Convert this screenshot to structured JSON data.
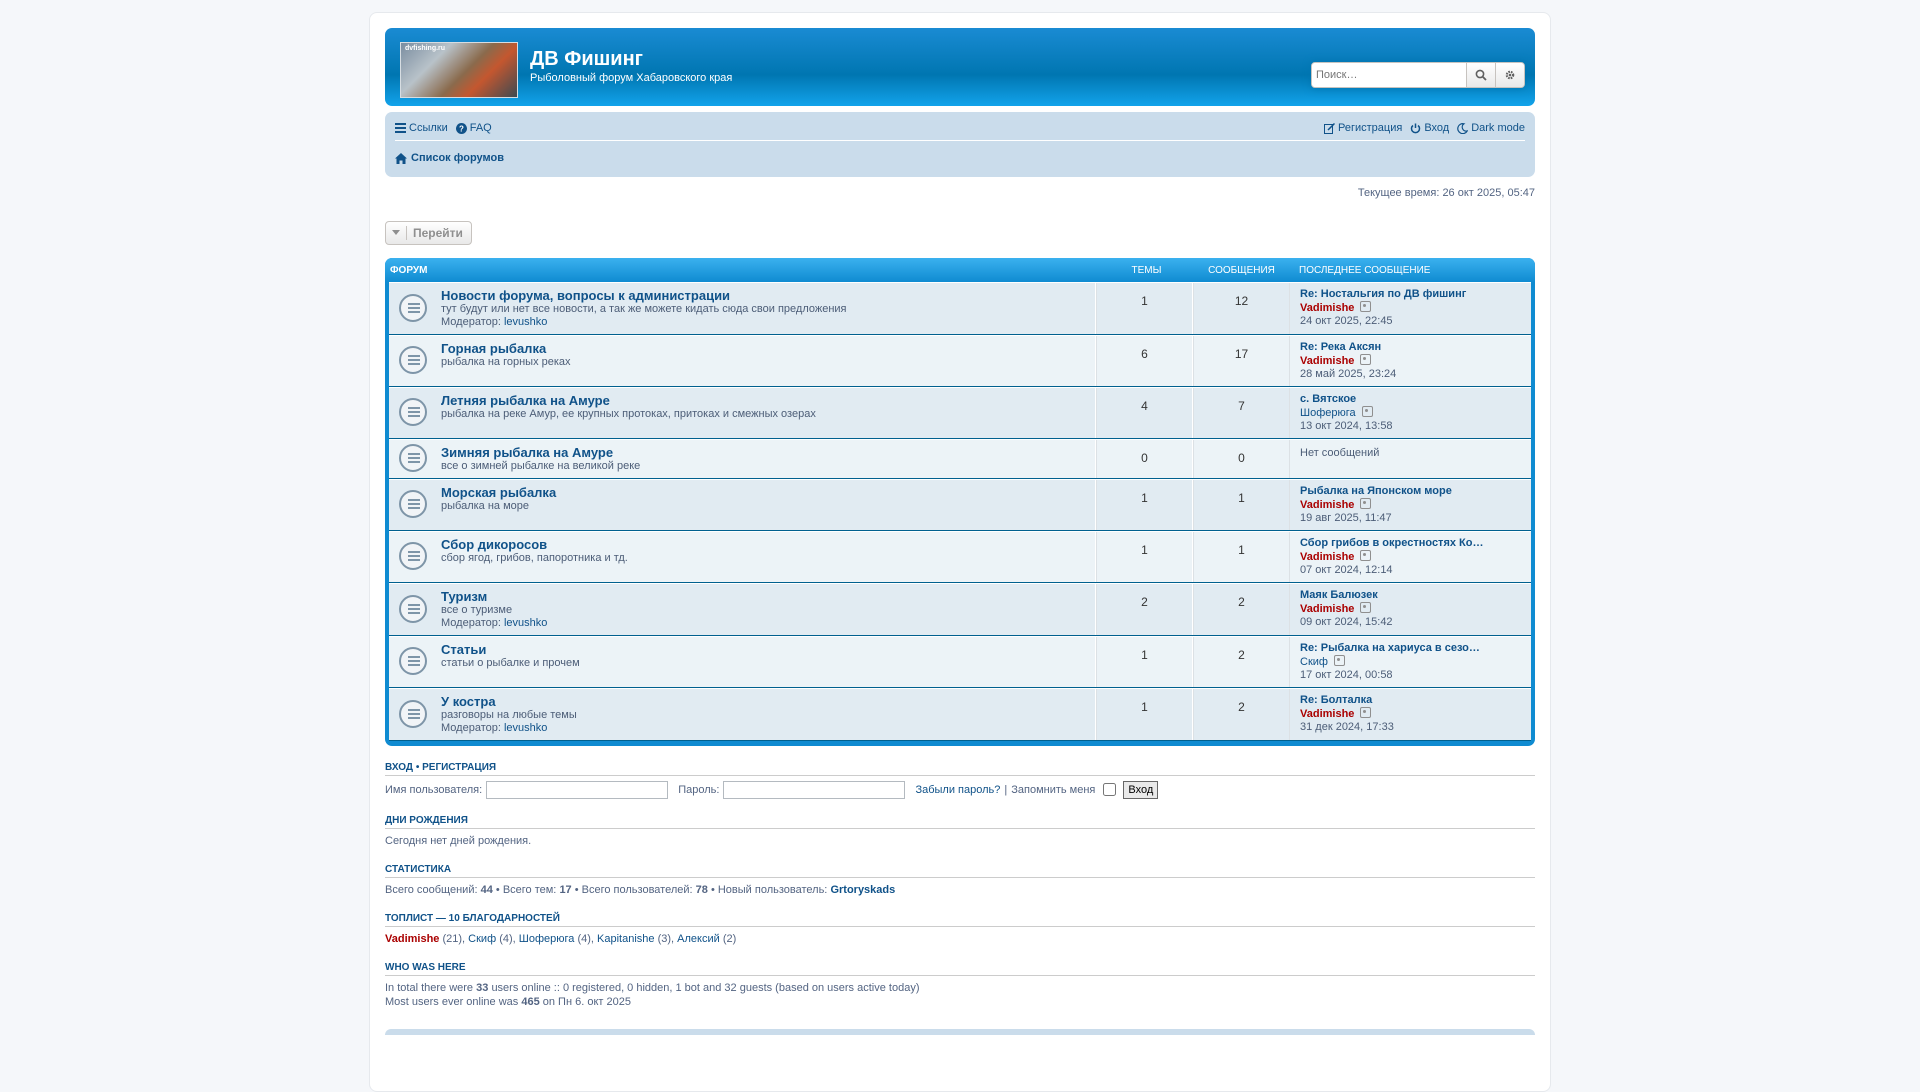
{
  "header": {
    "logo_text": "dvfishing.ru",
    "site_title": "ДВ Фишинг",
    "site_desc": "Рыболовный форум Хабаровского края",
    "search_placeholder": "Поиск…"
  },
  "nav": {
    "links": "Ссылки",
    "faq": "FAQ",
    "register": "Регистрация",
    "login": "Вход",
    "dark_mode": "Dark mode",
    "breadcrumb": "Список форумов"
  },
  "current_time": "Текущее время: 26 окт 2025, 05:47",
  "jump_label": "Перейти",
  "table_head": {
    "forum": "Форум",
    "topics": "Темы",
    "posts": "Сообщения",
    "last": "Последнее сообщение"
  },
  "moderator_label": "Модератор:",
  "forums": [
    {
      "title": "Новости форума, вопросы к администрации",
      "desc": "тут будут или нет все новости, а так же можете кидать сюда свои предложения",
      "moderator": "levushko",
      "topics": "1",
      "posts": "12",
      "lp_title": "Re: Ностальгия по ДВ фишинг",
      "lp_user": "Vadimishe",
      "lp_user_color": "#aa0000",
      "lp_date": "24 окт 2025, 22:45"
    },
    {
      "title": "Горная рыбалка",
      "desc": "рыбалка на горных реках",
      "moderator": "",
      "topics": "6",
      "posts": "17",
      "lp_title": "Re: Река Аксян",
      "lp_user": "Vadimishe",
      "lp_user_color": "#aa0000",
      "lp_date": "28 май 2025, 23:24"
    },
    {
      "title": "Летняя рыбалка на Амуре",
      "desc": "рыбалка на реке Амур, ее крупных протоках, притоках и смежных озерах",
      "moderator": "",
      "topics": "4",
      "posts": "7",
      "lp_title": "с. Вятское",
      "lp_user": "Шоферюга",
      "lp_user_color": "#105289",
      "lp_date": "13 окт 2024, 13:58"
    },
    {
      "title": "Зимняя рыбалка на Амуре",
      "desc": "все о зимней рыбалке на великой реке",
      "moderator": "",
      "topics": "0",
      "posts": "0",
      "lp_title": "",
      "lp_user": "",
      "lp_user_color": "",
      "lp_date": "",
      "lp_empty": "Нет сообщений"
    },
    {
      "title": "Морская рыбалка",
      "desc": "рыбалка на море",
      "moderator": "",
      "topics": "1",
      "posts": "1",
      "lp_title": "Рыбалка на Японском море",
      "lp_user": "Vadimishe",
      "lp_user_color": "#aa0000",
      "lp_date": "19 авг 2025, 11:47"
    },
    {
      "title": "Сбор дикоросов",
      "desc": "сбор ягод, грибов, папоротника и тд.",
      "moderator": "",
      "topics": "1",
      "posts": "1",
      "lp_title": "Сбор грибов в окрестностях Ко…",
      "lp_user": "Vadimishe",
      "lp_user_color": "#aa0000",
      "lp_date": "07 окт 2024, 12:14"
    },
    {
      "title": "Туризм",
      "desc": "все о туризме",
      "moderator": "levushko",
      "topics": "2",
      "posts": "2",
      "lp_title": "Маяк Балюзек",
      "lp_user": "Vadimishe",
      "lp_user_color": "#aa0000",
      "lp_date": "09 окт 2024, 15:42"
    },
    {
      "title": "Статьи",
      "desc": "статьи о рыбалке и прочем",
      "moderator": "",
      "topics": "1",
      "posts": "2",
      "lp_title": "Re: Рыбалка на хариуса в сезо…",
      "lp_user": "Скиф",
      "lp_user_color": "#105289",
      "lp_date": "17 окт 2024, 00:58"
    },
    {
      "title": "У костра",
      "desc": "разговоры на любые темы",
      "moderator": "levushko",
      "topics": "1",
      "posts": "2",
      "lp_title": "Re: Болталка",
      "lp_user": "Vadimishe",
      "lp_user_color": "#aa0000",
      "lp_date": "31 дек 2024, 17:33"
    }
  ],
  "login": {
    "head_login": "Вход",
    "head_sep": "•",
    "head_register": "Регистрация",
    "username_label": "Имя пользователя:",
    "password_label": "Пароль:",
    "forgot": "Забыли пароль?",
    "remember_sep": "|",
    "remember": "Запомнить меня",
    "submit": "Вход"
  },
  "birthdays": {
    "head": "Дни рождения",
    "text": "Сегодня нет дней рождения."
  },
  "stats": {
    "head": "Статистика",
    "posts_label": "Всего сообщений:",
    "posts": "44",
    "topics_label": "Всего тем:",
    "topics": "17",
    "users_label": "Всего пользователей:",
    "users": "78",
    "newest_label": "Новый пользователь:",
    "newest": "Grtoryskads"
  },
  "toplist": {
    "head": "Топлист — 10 благодарностей",
    "items": [
      {
        "name": "Vadimishe",
        "count": "(21)"
      },
      {
        "name": "Скиф",
        "count": "(4)"
      },
      {
        "name": "Шоферюга",
        "count": "(4)"
      },
      {
        "name": "Kapitanishe",
        "count": "(3)"
      },
      {
        "name": "Алексий",
        "count": "(2)"
      }
    ]
  },
  "who": {
    "head": "Who was here",
    "line1_a": "In total there were",
    "line1_num": "33",
    "line1_b": "users online :: 0 registered, 0 hidden, 1 bot and 32 guests (based on users active today)",
    "line2_a": "Most users ever online was",
    "line2_num": "465",
    "line2_b": "on Пн 6. окт 2025"
  }
}
